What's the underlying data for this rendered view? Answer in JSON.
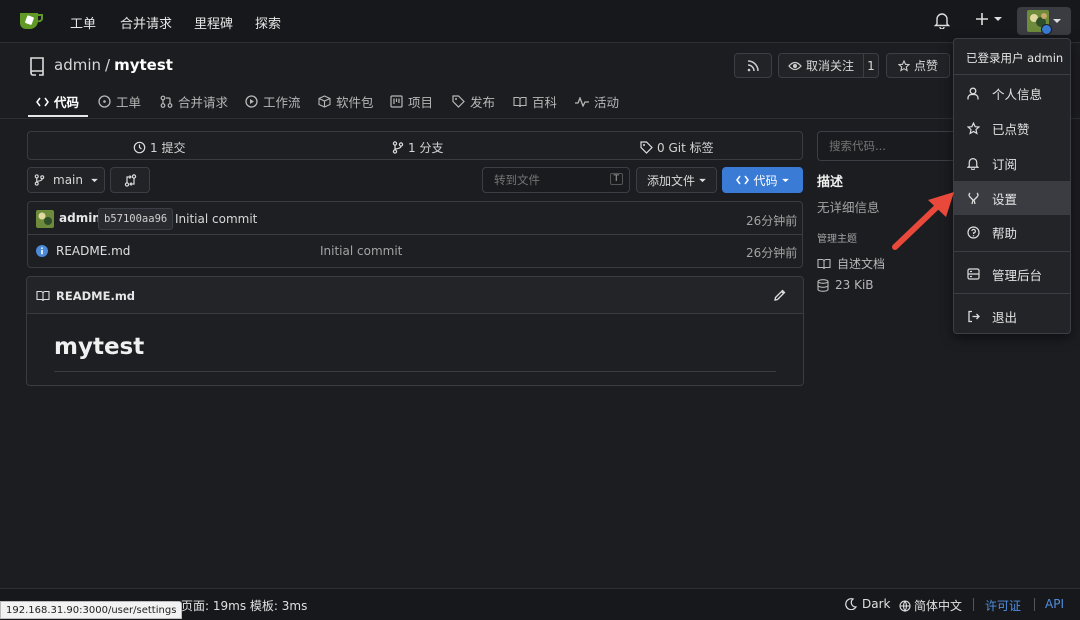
{
  "topnav": {
    "items": [
      "工单",
      "合并请求",
      "里程碑",
      "探索"
    ]
  },
  "repo": {
    "owner": "admin",
    "separator": "/",
    "name": "mytest",
    "unwatch_label": "取消关注",
    "watch_count": "1",
    "star_label": "点赞"
  },
  "tabs": [
    "代码",
    "工单",
    "合并请求",
    "工作流",
    "软件包",
    "项目",
    "发布",
    "百科",
    "活动"
  ],
  "stats": {
    "commits": "1 提交",
    "branches": "1 分支",
    "tags": "0 Git 标签"
  },
  "toolbar": {
    "branch": "main",
    "goto_placeholder": "转到文件",
    "goto_shortcut": "T",
    "add_file": "添加文件",
    "code_button": "代码"
  },
  "latest_commit": {
    "author": "admin",
    "sha": "b57100aa96",
    "message": "Initial commit",
    "time": "26分钟前"
  },
  "files": [
    {
      "name": "README.md",
      "message": "Initial commit",
      "time": "26分钟前"
    }
  ],
  "readme": {
    "filename": "README.md",
    "heading": "mytest"
  },
  "sidebar": {
    "search_placeholder": "搜索代码...",
    "about_title": "描述",
    "no_description": "无详细信息",
    "topics_label": "管理主题",
    "readme_link": "自述文档",
    "size": "23 KiB"
  },
  "dropdown": {
    "header": "已登录用户 admin",
    "items": [
      "个人信息",
      "已点赞",
      "订阅",
      "设置",
      "帮助",
      "管理后台",
      "退出"
    ]
  },
  "footer": {
    "status_url": "192.168.31.90:3000/user/settings",
    "timing": "页面: 19ms 模板: 3ms",
    "theme": "Dark",
    "language": "简体中文",
    "license": "许可证",
    "api": "API"
  },
  "colors": {
    "accent": "#3a7bd5",
    "arrow": "#e8493a",
    "logo": "#609926"
  }
}
